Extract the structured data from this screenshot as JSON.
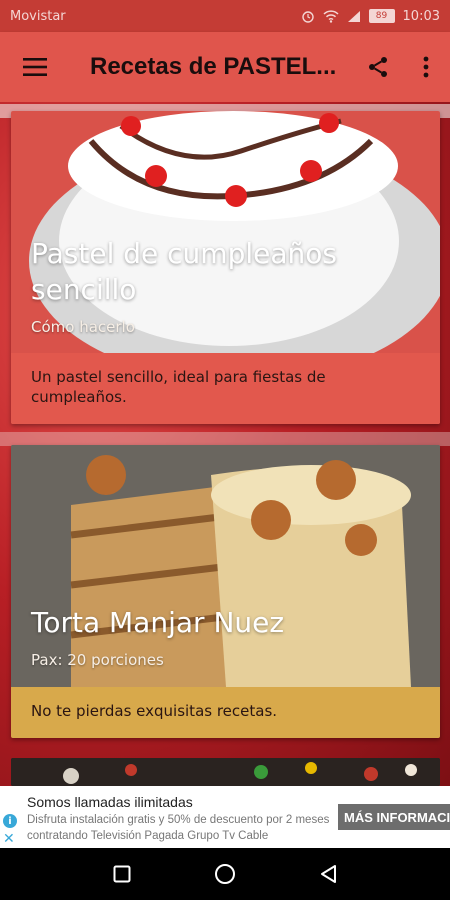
{
  "status_bar": {
    "carrier": "Movistar",
    "battery": "89",
    "time": "10:03"
  },
  "app_bar": {
    "title": "Recetas de PASTEL..."
  },
  "cards": [
    {
      "title": "Pastel de cumpleaños sencillo",
      "subtitle": "Cómo hacerlo",
      "description": "Un pastel sencillo, ideal para fiestas de cumpleaños.",
      "accent": "#e2584d"
    },
    {
      "title": "Torta Manjar Nuez",
      "subtitle": "Pax: 20 porciones",
      "description": "No te pierdas exquisitas recetas.",
      "accent": "#d8a94b"
    }
  ],
  "ad": {
    "headline": "Somos llamadas ilimitadas",
    "body_line1": "Disfruta instalación gratis y 50% de descuento por 2 meses",
    "body_line2": "contratando Televisión Pagada Grupo Tv Cable",
    "cta": "MÁS INFORMACIÓN"
  },
  "colors": {
    "primary": "#e0554c",
    "status_bar": "#c43c35"
  }
}
